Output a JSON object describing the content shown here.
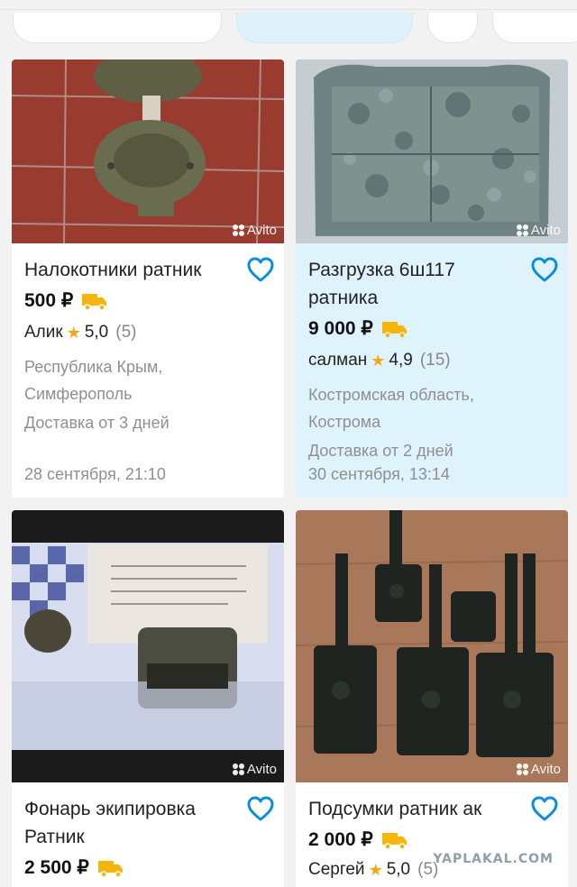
{
  "listings": [
    {
      "title": "Налокотники ратник",
      "price": "500 ₽",
      "seller": "Алик",
      "rating": "5,0",
      "reviews": "(5)",
      "location_line1": "Республика Крым,",
      "location_line2": "Симферополь",
      "delivery": "Доставка от 3 дней",
      "date": "28 сентября, 21:10",
      "photo_label": "Avito"
    },
    {
      "title_line1": "Разгрузка 6ш117",
      "title_line2": "ратника",
      "price": "9 000 ₽",
      "seller": "салман",
      "rating": "4,9",
      "reviews": "(15)",
      "location_line1": "Костромская область,",
      "location_line2": "Кострома",
      "delivery": "Доставка от 2 дней",
      "date": "30 сентября, 13:14",
      "photo_label": "Avito"
    },
    {
      "title_line1": "Фонарь экипировка",
      "title_line2": "Ратник",
      "price": "2 500 ₽",
      "photo_label": "Avito"
    },
    {
      "title": "Подсумки ратник ак",
      "price": "2 000 ₽",
      "seller": "Сергей",
      "rating": "5,0",
      "reviews": "(5)",
      "photo_label": "Avito"
    }
  ],
  "watermark": "YAPLAKAL.COM",
  "colors": {
    "accent": "#0a8ed9",
    "delivery_truck": "#f5b50a",
    "star": "#f3a712",
    "highlight_card": "#dff3fd"
  },
  "icons": [
    "heart-icon",
    "truck-icon",
    "star-icon",
    "avito-logo-icon"
  ]
}
